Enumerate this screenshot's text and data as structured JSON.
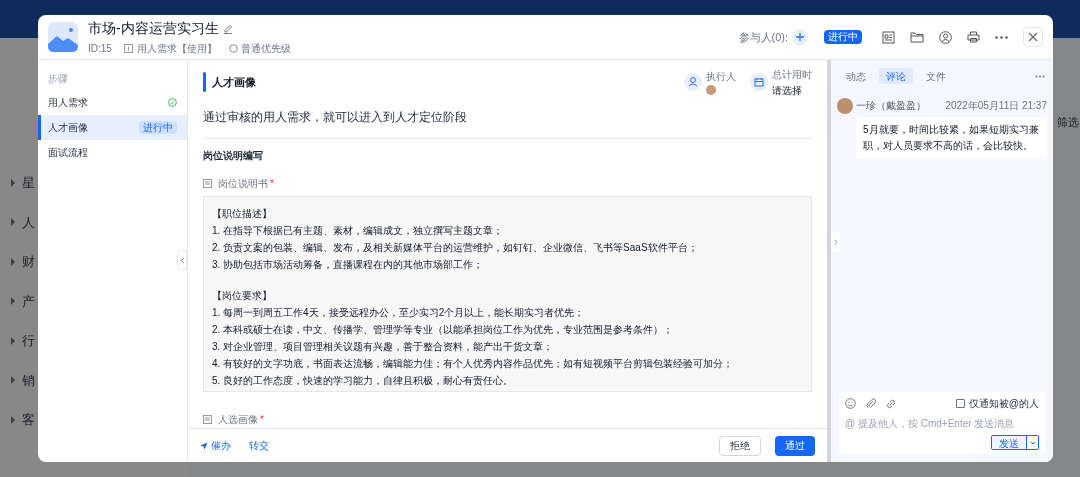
{
  "background": {
    "sidebar_fragments": [
      "星",
      "人",
      "财",
      "产",
      "行",
      "销",
      "客"
    ],
    "filter": "筛选"
  },
  "header": {
    "title": "市场-内容运营实习生",
    "id": "ID:15",
    "template": "用人需求【使用】",
    "priority": "普通优先级",
    "participants": "参与人(0):",
    "status": "进行中"
  },
  "steps": {
    "heading": "步骤",
    "items": [
      {
        "label": "用人需求",
        "done": true,
        "selected": false
      },
      {
        "label": "人才画像",
        "done": false,
        "badge": "进行中",
        "selected": true
      },
      {
        "label": "面试流程",
        "done": false,
        "selected": false
      }
    ]
  },
  "stage": {
    "title": "人才画像",
    "assignee_label": "执行人",
    "time_label": "总计用时",
    "time_value": "请选择",
    "description": "通过审核的用人需求，就可以进入到人才定位阶段",
    "section": "岗位说明编写",
    "fields": [
      {
        "label": "岗位说明书",
        "required_mark": "*",
        "paragraphs": [
          {
            "heading": "【职位描述】",
            "lines": [
              "1. 在指导下根据已有主题、素材，编辑成文，独立撰写主题文章；",
              "2. 负责文案的包装、编辑、发布，及相关新媒体平台的运营维护，如钉钉、企业微信、飞书等SaaS软件平台；",
              "3. 协助包括市场活动筹备，直播课程在内的其他市场部工作；"
            ]
          },
          {
            "heading": "【岗位要求】",
            "lines": [
              "1. 每周一到周五工作4天，接受远程办公，至少实习2个月以上，能长期实习者优先；",
              "2. 本科或硕士在读，中文、传播学、管理学等专业（以能承担岗位工作为优先，专业范围是参考条件）；",
              "3. 对企业管理、项目管理相关议题有兴趣，善于整合资料，能产出干货文章；",
              "4. 有较好的文字功底，书面表达流畅，编辑能力佳；有个人优秀内容作品优先；如有短视频平台剪辑包装经验可加分；",
              "5. 良好的工作态度，快速的学习能力，自律且积极，耐心有责任心。"
            ]
          }
        ]
      },
      {
        "label": "人选画像",
        "required_mark": "*"
      }
    ]
  },
  "footer": {
    "links": [
      {
        "kind": "remind",
        "label": "催办"
      },
      {
        "kind": "plain",
        "label": "转交"
      }
    ],
    "reject": "拒绝",
    "approve": "通过"
  },
  "comments": {
    "tabs": [
      {
        "label": "动态",
        "selected": false
      },
      {
        "label": "评论",
        "selected": true
      },
      {
        "label": "文件",
        "selected": false
      }
    ],
    "items": [
      {
        "author": "一珍（戴盈盈）",
        "time": "2022年05月11日 21:37",
        "text": "5月就要，时间比较紧，如果短期实习兼职，对人员要求不高的话，会比较快。"
      }
    ],
    "notify_label": "仅通知被@的人",
    "notify_checked": false,
    "placeholder": "@ 提及他人，按 Cmd+Enter 发送消息",
    "send": "发送"
  }
}
